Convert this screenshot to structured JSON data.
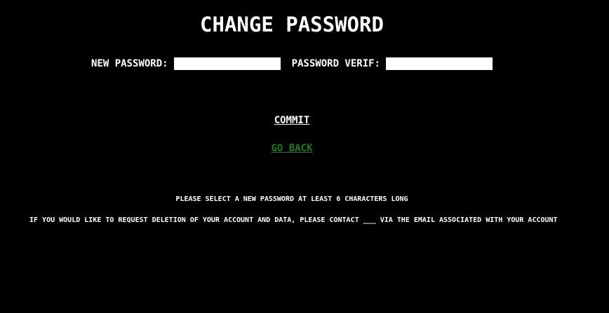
{
  "title": "CHANGE PASSWORD",
  "form": {
    "new_password_label": "NEW PASSWORD:",
    "new_password_value": "",
    "verify_label": "PASSWORD VERIF:",
    "verify_value": ""
  },
  "actions": {
    "commit_label": "COMMIT",
    "go_back_label": "GO BACK"
  },
  "notes": {
    "min_length": "PLEASE SELECT A NEW PASSWORD AT LEAST 6 CHARACTERS LONG",
    "deletion": "IF YOU WOULD LIKE TO REQUEST DELETION OF YOUR ACCOUNT AND DATA, PLEASE CONTACT ___ VIA THE EMAIL ASSOCIATED WITH YOUR ACCOUNT"
  },
  "colors": {
    "background": "#000000",
    "text": "#ffffff",
    "go_back": "#1e7a1e"
  }
}
